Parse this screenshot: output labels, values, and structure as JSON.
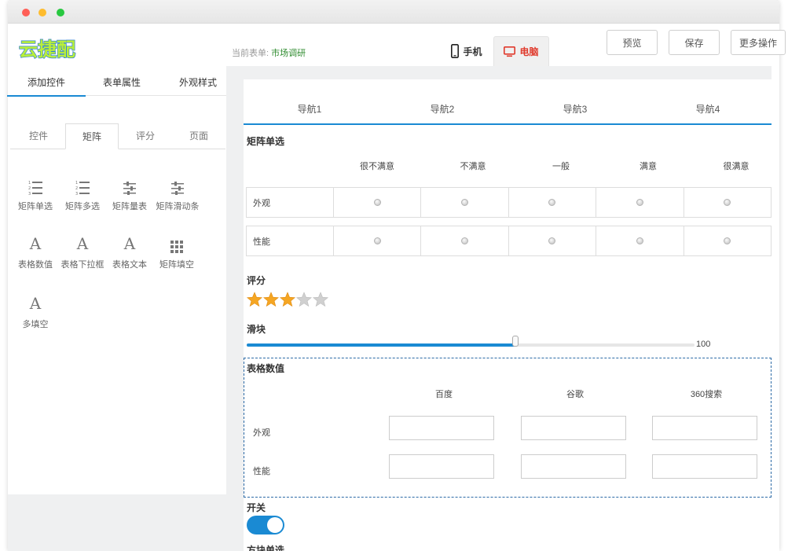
{
  "header": {
    "logo_text": "云捷配",
    "current_form_label": "当前表单:",
    "current_form_value": "市场调研",
    "tab_phone": "手机",
    "tab_pc": "电脑",
    "btn_preview": "预览",
    "btn_save": "保存",
    "btn_more": "更多操作"
  },
  "sidebar": {
    "tabs": [
      "添加控件",
      "表单属性",
      "外观样式"
    ],
    "active_tab": "添加控件",
    "subtabs": [
      "控件",
      "矩阵",
      "评分",
      "页面"
    ],
    "active_subtab": "矩阵",
    "controls": [
      {
        "label": "矩阵单选",
        "icon": "numbered-list-icon"
      },
      {
        "label": "矩阵多选",
        "icon": "numbered-list-icon"
      },
      {
        "label": "矩阵量表",
        "icon": "sliders-icon"
      },
      {
        "label": "矩阵滑动条",
        "icon": "sliders-icon"
      },
      {
        "label": "表格数值",
        "icon": "letter-a-icon"
      },
      {
        "label": "表格下拉框",
        "icon": "letter-a-icon"
      },
      {
        "label": "表格文本",
        "icon": "letter-a-icon"
      },
      {
        "label": "矩阵填空",
        "icon": "grid-icon"
      },
      {
        "label": "多填空",
        "icon": "letter-a-icon"
      }
    ]
  },
  "form": {
    "nav": [
      "导航1",
      "导航2",
      "导航3",
      "导航4"
    ],
    "matrix_radio": {
      "title": "矩阵单选",
      "columns": [
        "很不满意",
        "不满意",
        "一般",
        "满意",
        "很满意"
      ],
      "rows": [
        "外观",
        "性能"
      ]
    },
    "rating": {
      "title": "评分",
      "value": 3,
      "max": 5
    },
    "slider": {
      "title": "滑块",
      "value_fraction": 0.6,
      "max_label": "100"
    },
    "table_values": {
      "title": "表格数值",
      "columns": [
        "百度",
        "谷歌",
        "360搜索"
      ],
      "rows": [
        "外观",
        "性能"
      ]
    },
    "switch": {
      "title": "开关",
      "on": true
    },
    "next_section_title": "方块单选"
  },
  "colors": {
    "accent": "#1a8ad3",
    "pc_tab": "#e03a2c",
    "form_name": "#2e8b2e",
    "star_on": "#f5a623",
    "star_off": "#d0d0d0"
  }
}
